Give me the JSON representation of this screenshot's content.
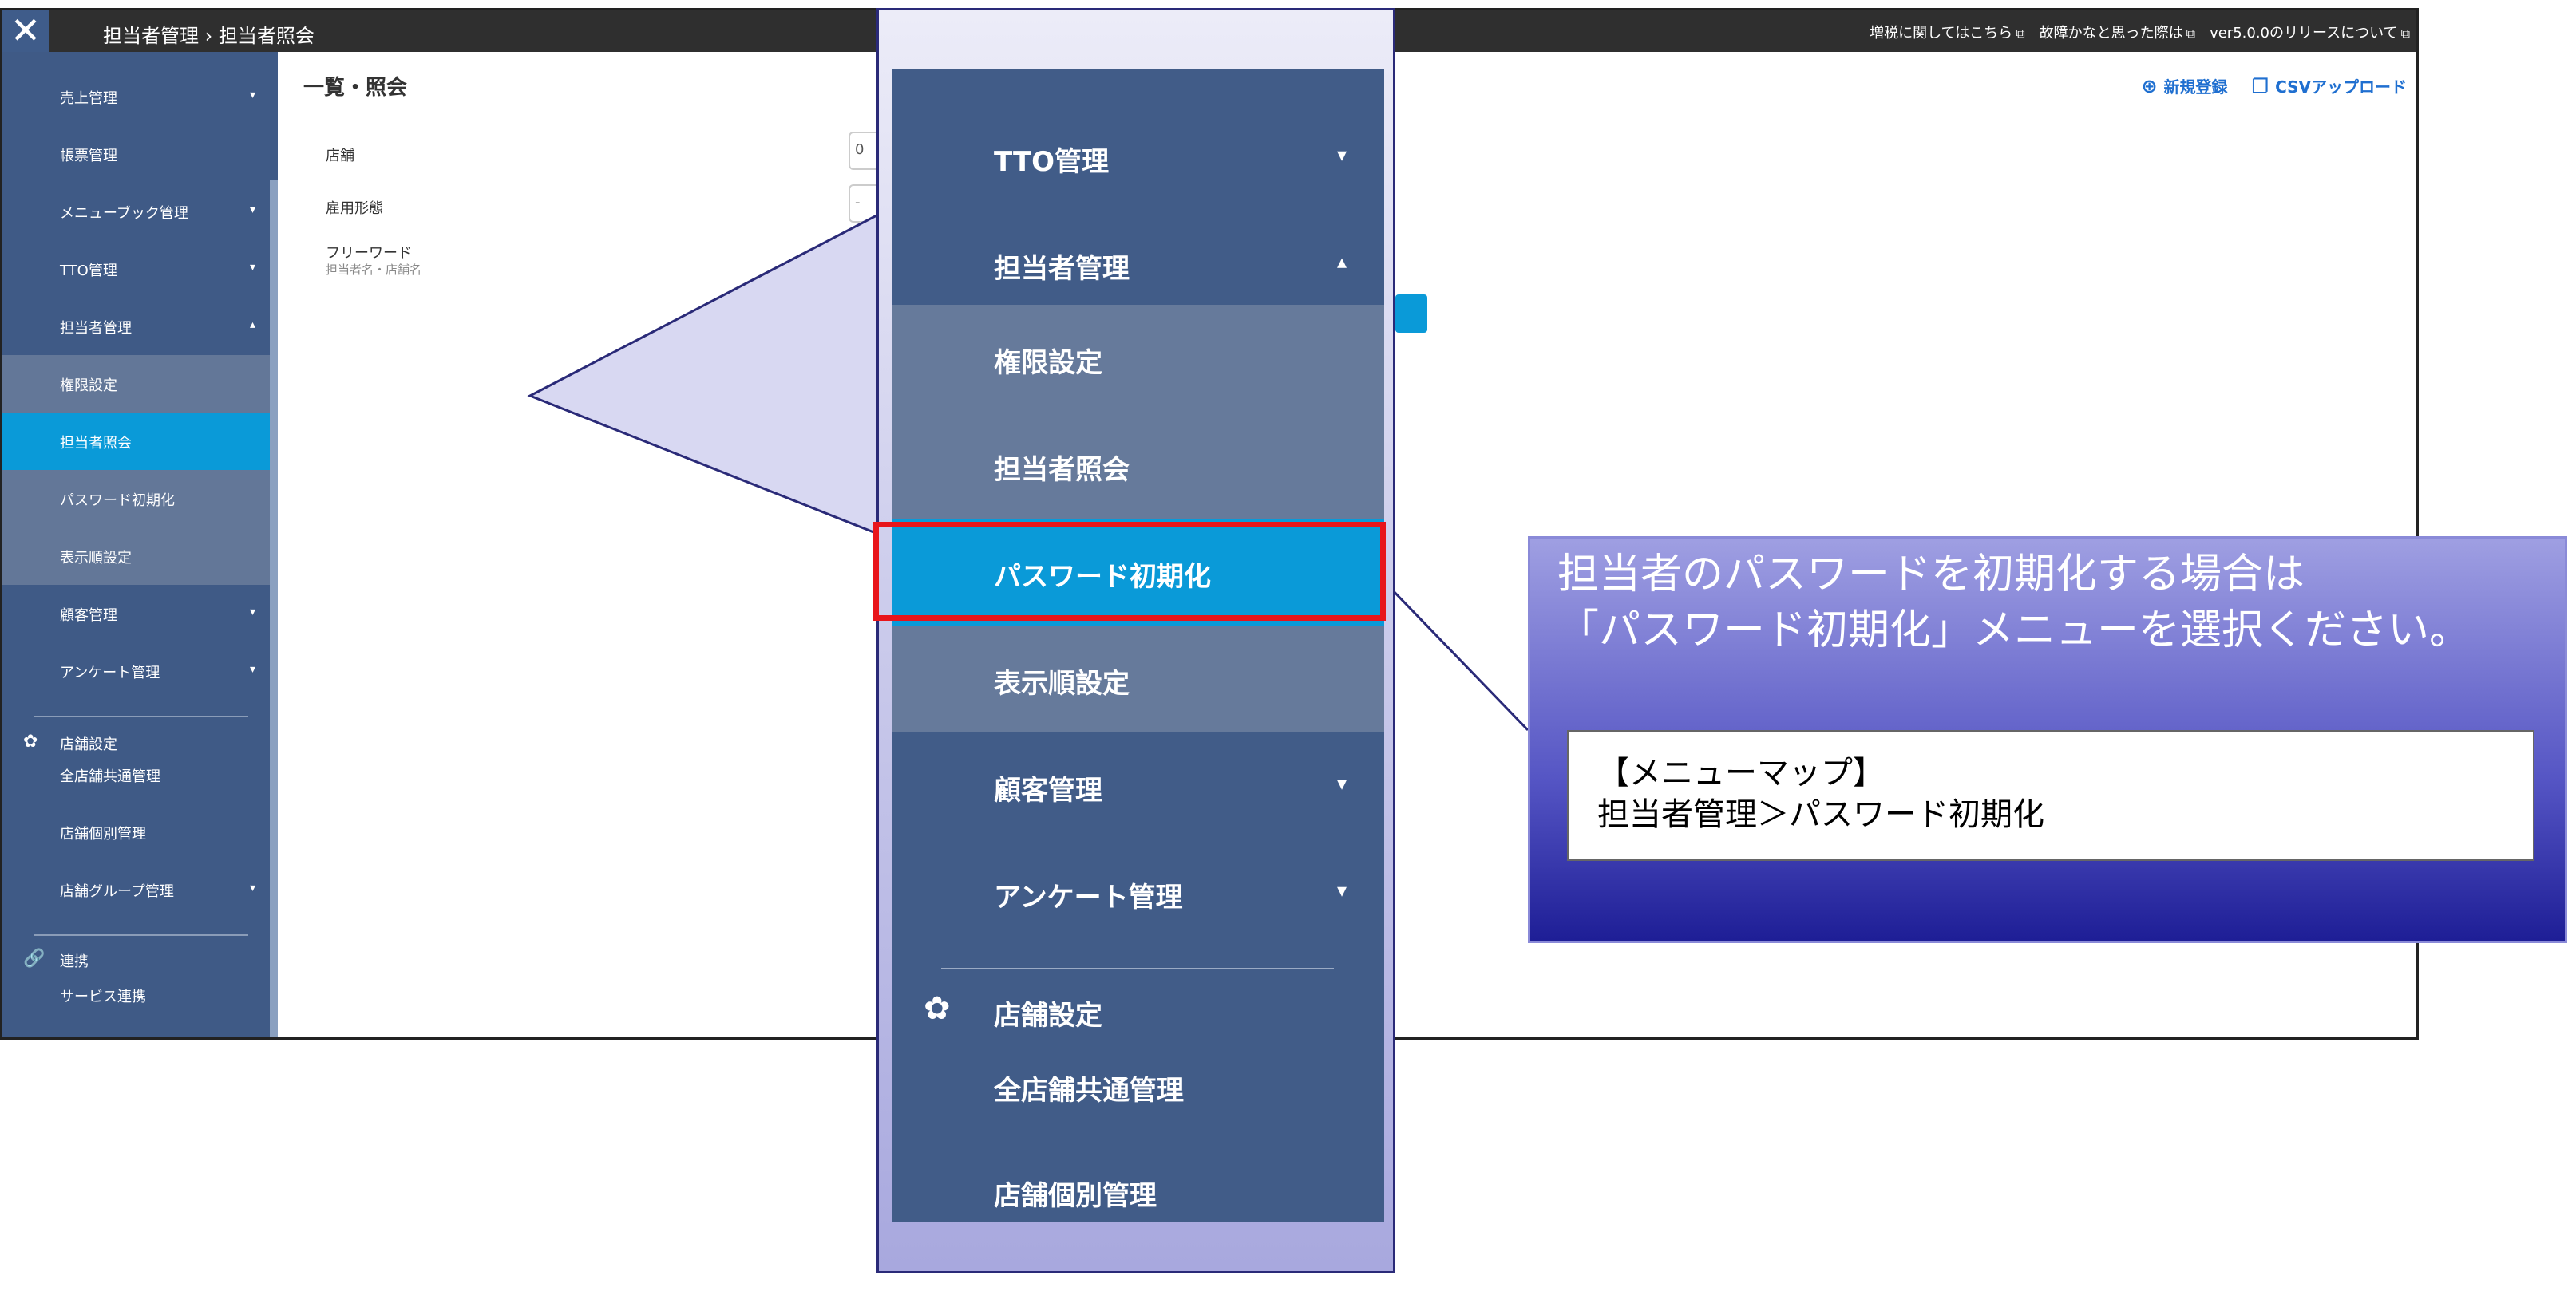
{
  "topbar": {
    "close_icon": "close-icon",
    "breadcrumb_1": "担当者管理",
    "breadcrumb_sep": "›",
    "breadcrumb_2": "担当者照会",
    "link_tax": "増税に関してはこちら",
    "link_fault": "故障かなと思った際は",
    "link_release": "ver5.0.0のリリースについて"
  },
  "sidebar": {
    "items": [
      {
        "label": "売上管理",
        "chev": "▾"
      },
      {
        "label": "帳票管理",
        "chev": ""
      },
      {
        "label": "メニューブック管理",
        "chev": "▾"
      },
      {
        "label": "TTO管理",
        "chev": "▾"
      },
      {
        "label": "担当者管理",
        "chev": "▴"
      },
      {
        "label": "権限設定",
        "chev": ""
      },
      {
        "label": "担当者照会",
        "chev": ""
      },
      {
        "label": "パスワード初期化",
        "chev": ""
      },
      {
        "label": "表示順設定",
        "chev": ""
      },
      {
        "label": "顧客管理",
        "chev": "▾"
      },
      {
        "label": "アンケート管理",
        "chev": "▾"
      }
    ],
    "store_section": "店舗設定",
    "store_items": [
      {
        "label": "全店舗共通管理",
        "chev": ""
      },
      {
        "label": "店舗個別管理",
        "chev": ""
      },
      {
        "label": "店舗グループ管理",
        "chev": "▾"
      }
    ],
    "link_section": "連携",
    "link_items": [
      {
        "label": "サービス連携"
      }
    ]
  },
  "content": {
    "title": "一覧・照会",
    "field_store": "店舗",
    "field_store_value": "0",
    "field_employment": "雇用形態",
    "field_employment_value": "-",
    "field_freeword": "フリーワード",
    "field_freeword_hint": "担当者名・店舗名",
    "action_new": "新規登録",
    "action_csv": "CSVアップロード"
  },
  "zoom_menu": {
    "items": [
      {
        "label": "TTO管理",
        "chev": "▾"
      },
      {
        "label": "担当者管理",
        "chev": "▴"
      },
      {
        "label": "権限設定",
        "chev": ""
      },
      {
        "label": "担当者照会",
        "chev": ""
      },
      {
        "label": "パスワード初期化",
        "chev": ""
      },
      {
        "label": "表示順設定",
        "chev": ""
      },
      {
        "label": "顧客管理",
        "chev": "▾"
      },
      {
        "label": "アンケート管理",
        "chev": "▾"
      }
    ],
    "section": "店舗設定",
    "section_items": [
      {
        "label": "全店舗共通管理"
      },
      {
        "label": "店舗個別管理"
      }
    ]
  },
  "info": {
    "line1": "担当者のパスワードを初期化する場合は",
    "line2": "「パスワード初期化」メニューを選択ください。",
    "map_title": "【メニューマップ】",
    "map_path": "担当者管理＞パスワード初期化"
  },
  "colors": {
    "sidebar": "#3f5a86",
    "sub": "#637798",
    "active": "#0a9ad8",
    "highlight": "#e8151b"
  }
}
